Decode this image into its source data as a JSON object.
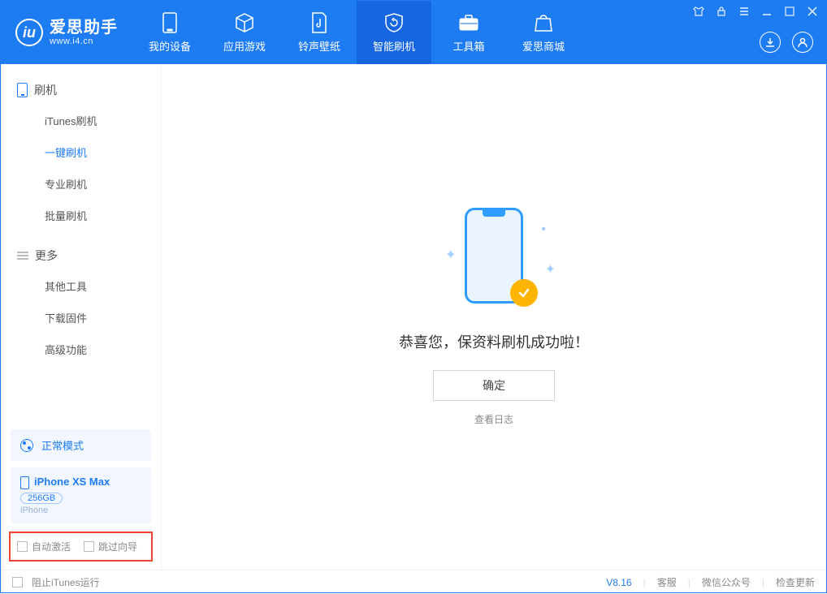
{
  "app": {
    "name": "爱思助手",
    "domain": "www.i4.cn"
  },
  "nav": {
    "device": "我的设备",
    "apps": "应用游戏",
    "ringtones": "铃声壁纸",
    "flash": "智能刷机",
    "toolbox": "工具箱",
    "store": "爱思商城"
  },
  "sidebar": {
    "flash_section": "刷机",
    "items": {
      "itunes": "iTunes刷机",
      "onekey": "一键刷机",
      "pro": "专业刷机",
      "batch": "批量刷机"
    },
    "more_section": "更多",
    "more_items": {
      "other": "其他工具",
      "firmware": "下载固件",
      "advanced": "高级功能"
    },
    "mode_label": "正常模式",
    "device": {
      "name": "iPhone XS Max",
      "capacity": "256GB",
      "type": "iPhone"
    },
    "chk_auto": "自动激活",
    "chk_skip": "跳过向导"
  },
  "main": {
    "success": "恭喜您，保资料刷机成功啦！",
    "ok": "确定",
    "view_log": "查看日志"
  },
  "footer": {
    "block_itunes": "阻止iTunes运行",
    "version": "V8.16",
    "support": "客服",
    "wechat": "微信公众号",
    "update": "检查更新"
  }
}
